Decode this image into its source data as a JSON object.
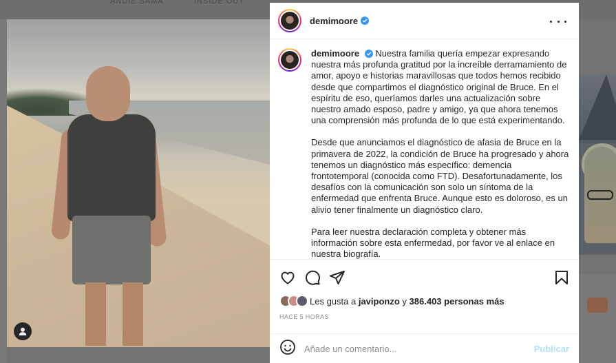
{
  "background": {
    "top_labels": [
      "ANDIE SAMA",
      "INSIDE OUT"
    ]
  },
  "post": {
    "username": "demimoore",
    "verified": true,
    "caption_paragraphs": [
      "Nuestra familia quería empezar expresando nuestra más profunda gratitud por la increíble derramamiento de amor, apoyo e historias maravillosas que todos hemos recibido desde que compartimos el diagnóstico original de Bruce. En el espíritu de eso, queríamos darles una actualización sobre nuestro amado esposo, padre y amigo, ya que ahora tenemos una comprensión más profunda de lo que está experimentando.",
      "Desde que anunciamos el diagnóstico de afasia de Bruce en la primavera de 2022, la condición de Bruce ha progresado y ahora tenemos un diagnóstico más específico: demencia frontotemporal (conocida como FTD). Desafortunadamente, los desafíos con la comunicación son solo un síntoma de la enfermedad que enfrenta Bruce. Aunque esto es doloroso, es un alivio tener finalmente un diagnóstico claro.",
      "Para leer nuestra declaración completa y obtener más información sobre esta enfermedad, por favor ve al enlace en nuestra biografía."
    ],
    "likes": {
      "prefix": "Les gusta a",
      "first_user": "javiponzo",
      "joiner": "y",
      "others": "386.403 personas más"
    },
    "timestamp": "HACE 5 HORAS",
    "comment": {
      "placeholder": "Añade un comentario...",
      "post_label": "Publicar"
    }
  },
  "colors": {
    "accent_blue": "#0095f6",
    "post_button_disabled": "#b2dffc",
    "verified_badge": "#3897f0",
    "text_primary": "#262626",
    "text_secondary": "#8e8e8e",
    "overlay": "#737373"
  },
  "icons": [
    "user-tag-icon",
    "verified-badge-icon",
    "more-options-icon",
    "heart-icon",
    "comment-icon",
    "share-icon",
    "bookmark-icon",
    "emoji-icon"
  ]
}
